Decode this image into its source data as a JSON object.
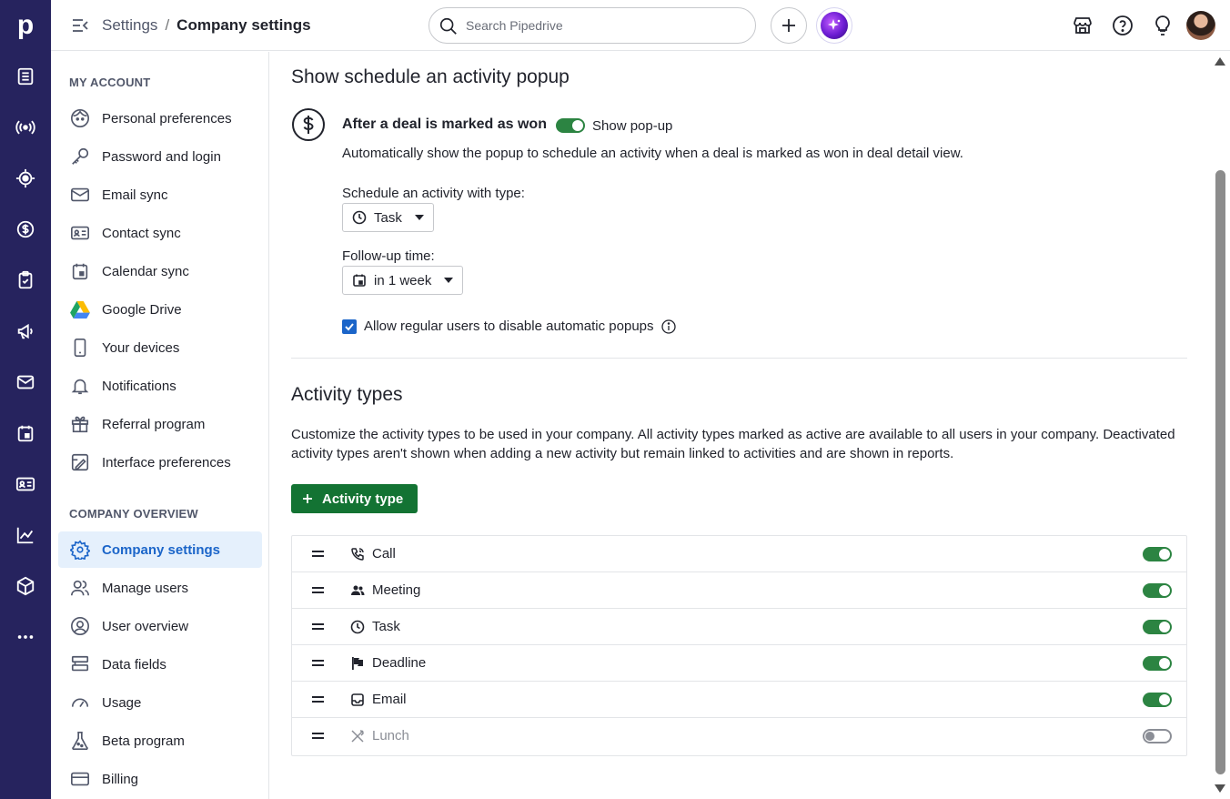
{
  "app": {
    "logo_letter": "p"
  },
  "topbar": {
    "breadcrumb_parent": "Settings",
    "breadcrumb_separator": "/",
    "breadcrumb_current": "Company settings",
    "search_placeholder": "Search Pipedrive"
  },
  "rail": {
    "icons": [
      "leads-icon",
      "radar-icon",
      "focus-icon",
      "deals-icon",
      "tasks-icon",
      "campaigns-icon",
      "mail-icon",
      "calendar-icon",
      "contacts-icon",
      "insights-icon",
      "products-icon",
      "more-icon"
    ]
  },
  "sidebar": {
    "my_account_title": "MY ACCOUNT",
    "my_account": [
      {
        "label": "Personal preferences",
        "icon": "face-icon"
      },
      {
        "label": "Password and login",
        "icon": "key-icon"
      },
      {
        "label": "Email sync",
        "icon": "mail-icon"
      },
      {
        "label": "Contact sync",
        "icon": "contact-card-icon"
      },
      {
        "label": "Calendar sync",
        "icon": "calendar-icon"
      },
      {
        "label": "Google Drive",
        "icon": "google-drive-icon"
      },
      {
        "label": "Your devices",
        "icon": "phone-icon"
      },
      {
        "label": "Notifications",
        "icon": "bell-icon"
      },
      {
        "label": "Referral program",
        "icon": "gift-icon"
      },
      {
        "label": "Interface preferences",
        "icon": "interface-icon"
      }
    ],
    "company_title": "COMPANY OVERVIEW",
    "company": [
      {
        "label": "Company settings",
        "icon": "gear-icon",
        "active": true
      },
      {
        "label": "Manage users",
        "icon": "users-icon"
      },
      {
        "label": "User overview",
        "icon": "user-circle-icon"
      },
      {
        "label": "Data fields",
        "icon": "data-fields-icon"
      },
      {
        "label": "Usage",
        "icon": "gauge-icon"
      },
      {
        "label": "Beta program",
        "icon": "flask-icon"
      },
      {
        "label": "Billing",
        "icon": "credit-card-icon"
      }
    ]
  },
  "popup_section": {
    "title": "Show schedule an activity popup",
    "won_title": "After a deal is marked as won",
    "toggle_label": "Show pop-up",
    "toggle_on": true,
    "description": "Automatically show the popup to schedule an activity when a deal is marked as won in deal detail view.",
    "type_label": "Schedule an activity with type:",
    "type_value": "Task",
    "followup_label": "Follow-up time:",
    "followup_value": "in 1 week",
    "checkbox_label": "Allow regular users to disable automatic popups",
    "checkbox_checked": true
  },
  "activity_types": {
    "title": "Activity types",
    "description_line1": "Customize the activity types to be used in your company. All activity types marked as active are available to all users in your company. Deactivated",
    "description_line2": "activity types aren't shown when adding a new activity but remain linked to activities and are shown in reports.",
    "add_button": "Activity type",
    "types": [
      {
        "label": "Call",
        "icon": "phone-call-icon",
        "active": true
      },
      {
        "label": "Meeting",
        "icon": "meeting-icon",
        "active": true
      },
      {
        "label": "Task",
        "icon": "clock-icon",
        "active": true
      },
      {
        "label": "Deadline",
        "icon": "flag-icon",
        "active": true
      },
      {
        "label": "Email",
        "icon": "inbox-icon",
        "active": true
      },
      {
        "label": "Lunch",
        "icon": "utensils-icon",
        "active": false
      }
    ]
  },
  "colors": {
    "rail": "#26235e",
    "accent_green": "#137333",
    "toggle_green": "#2c8442",
    "active_blue": "#1b65c9",
    "active_bg": "#e5f0fc"
  }
}
